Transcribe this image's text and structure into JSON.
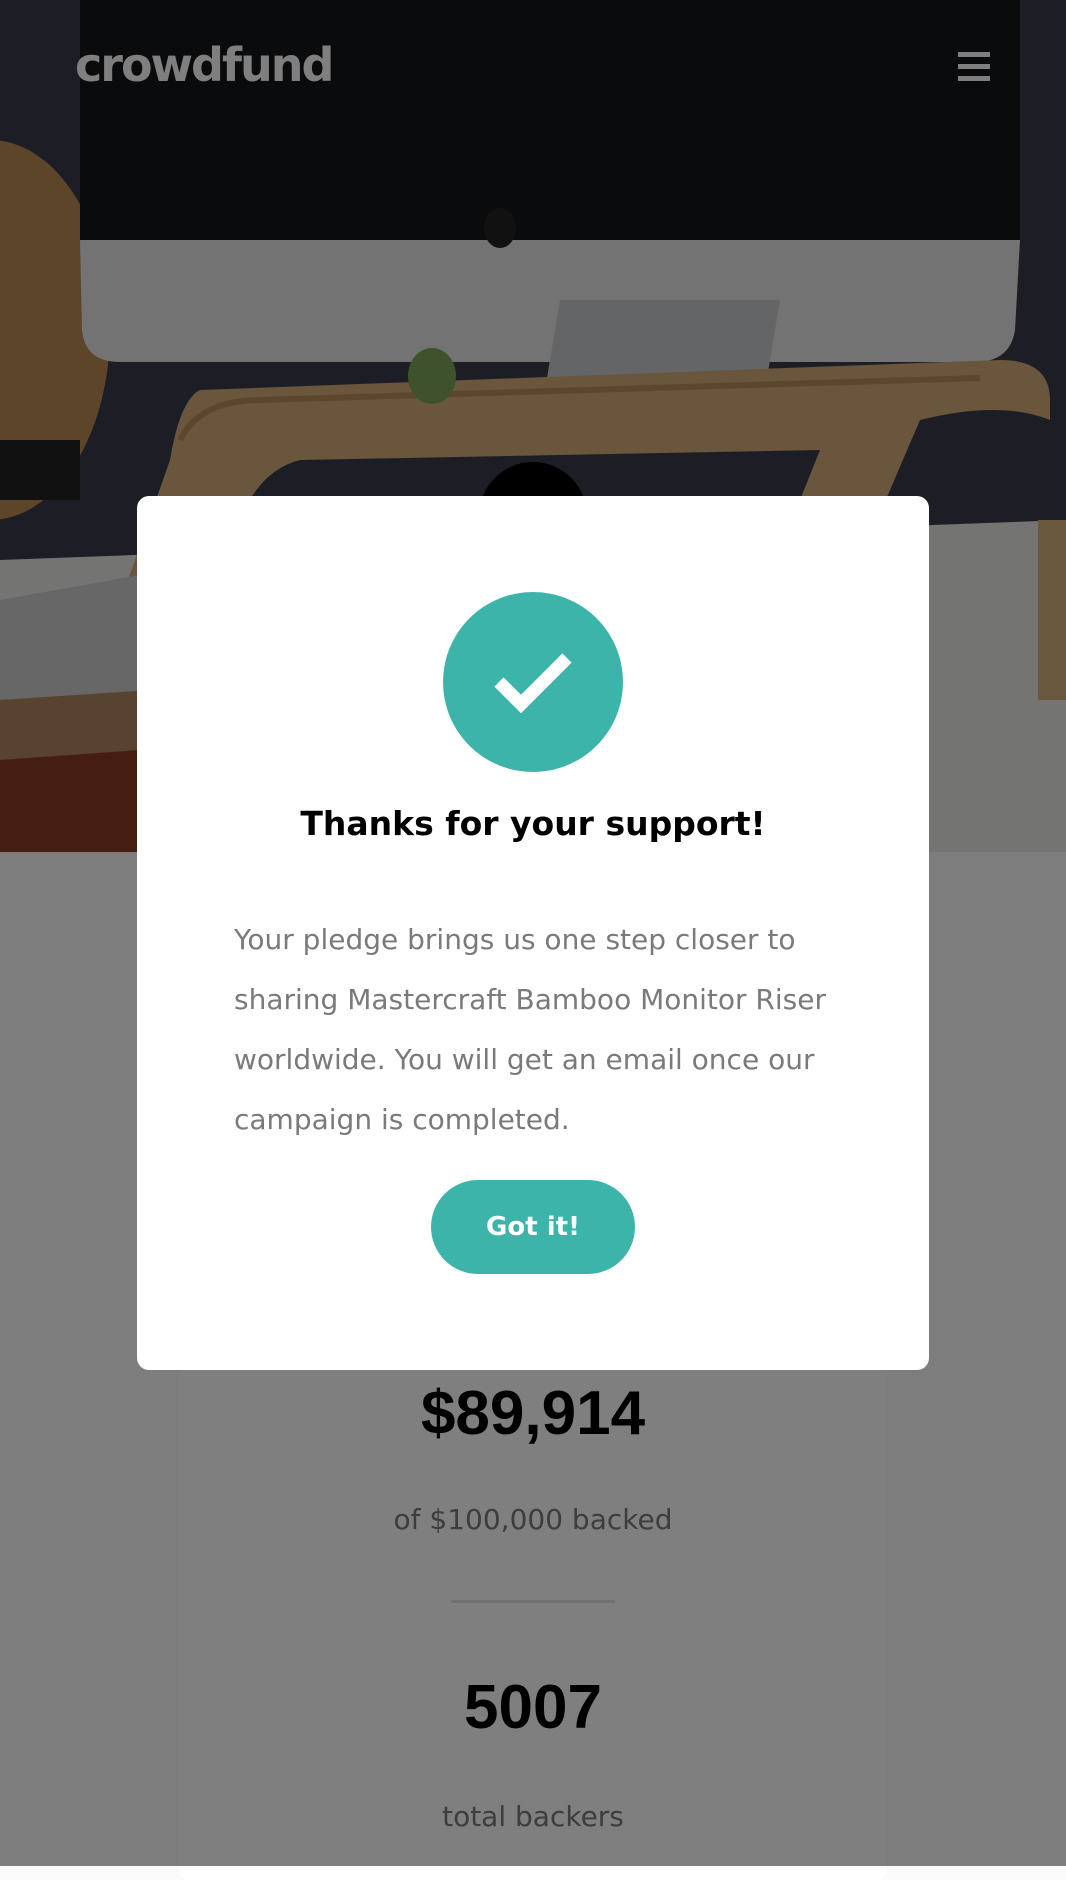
{
  "header": {
    "logo_text": "crowdfund",
    "menu_icon": "hamburger-menu-icon"
  },
  "stats": {
    "amount": "$89,914",
    "amount_label": "of $100,000 backed",
    "backers": "5007",
    "backers_label": "total backers"
  },
  "modal": {
    "icon": "check-icon",
    "title": "Thanks for your support!",
    "body": "Your pledge brings us one step closer to sharing Mastercraft Bamboo Monitor Riser worldwide. You will get an email once our campaign is completed.",
    "button_label": "Got it!"
  },
  "colors": {
    "accent": "#3db4a9",
    "overlay": "rgba(0,0,0,0.5)"
  }
}
